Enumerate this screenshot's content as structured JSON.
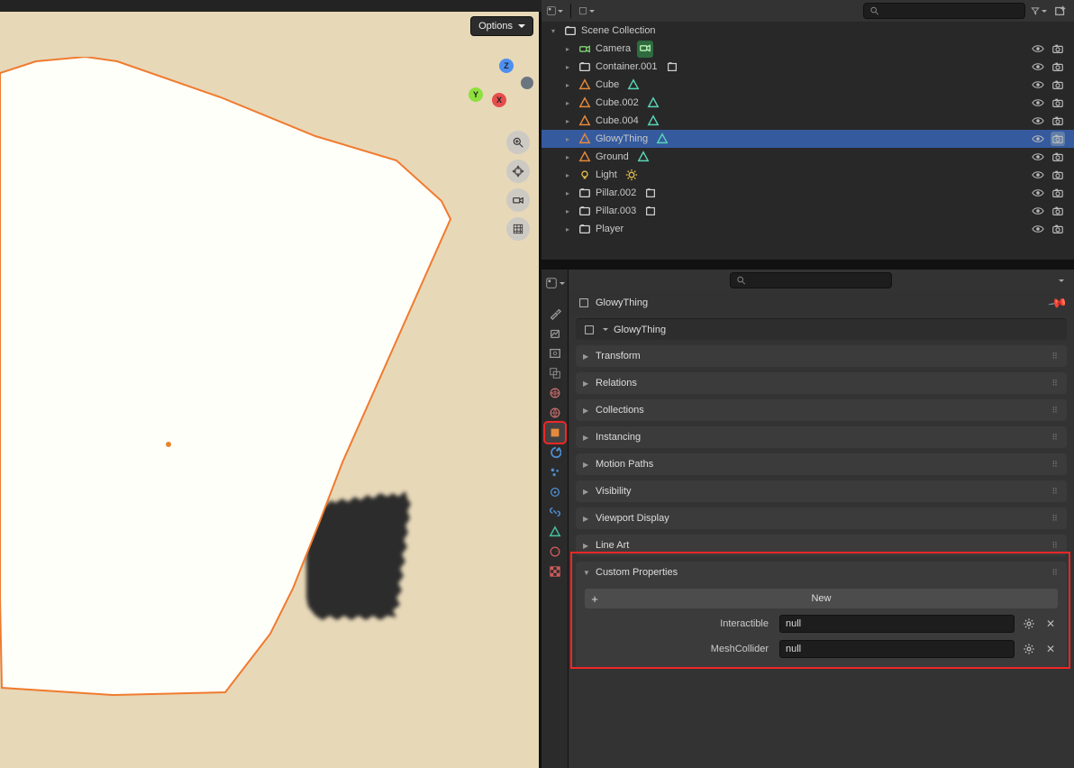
{
  "viewport": {
    "options_label": "Options",
    "gizmo": {
      "z": "Z",
      "y": "Y",
      "x": "X"
    },
    "origin_color": "#e78429",
    "mesh_stroke": "#f07b2f",
    "bg_color": "#e7d8b8"
  },
  "top_toolbar_icons": [
    "cursor",
    "select-box",
    "lasso",
    "circle",
    "tweak",
    "shear"
  ],
  "outliner": {
    "search_placeholder": "",
    "root": {
      "name": "Scene Collection",
      "type": "collection"
    },
    "items": [
      {
        "name": "Camera",
        "type": "camera",
        "extra": "cam",
        "visible": true,
        "render": true
      },
      {
        "name": "Container.001",
        "type": "collection",
        "extra": "box",
        "visible": true,
        "render": true
      },
      {
        "name": "Cube",
        "type": "mesh",
        "extra": "mesh-teal",
        "visible": true,
        "render": true
      },
      {
        "name": "Cube.002",
        "type": "mesh",
        "extra": "mesh-teal",
        "visible": true,
        "render": true
      },
      {
        "name": "Cube.004",
        "type": "mesh",
        "extra": "mesh-teal",
        "visible": true,
        "render": true
      },
      {
        "name": "GlowyThing",
        "type": "mesh",
        "extra": "mesh-teal",
        "visible": true,
        "render": true,
        "selected": true
      },
      {
        "name": "Ground",
        "type": "mesh",
        "extra": "mesh-teal",
        "visible": true,
        "render": true
      },
      {
        "name": "Light",
        "type": "light",
        "extra": "light",
        "visible": true,
        "render": true
      },
      {
        "name": "Pillar.002",
        "type": "collection",
        "extra": "box",
        "visible": true,
        "render": true
      },
      {
        "name": "Pillar.003",
        "type": "collection",
        "extra": "box",
        "visible": true,
        "render": true
      },
      {
        "name": "Player",
        "type": "collection",
        "extra": null,
        "visible": true,
        "render": true
      }
    ]
  },
  "properties": {
    "search_placeholder": "",
    "breadcrumb_object": "GlowyThing",
    "object_name_field": "GlowyThing",
    "panels": [
      {
        "label": "Transform",
        "open": false
      },
      {
        "label": "Relations",
        "open": false
      },
      {
        "label": "Collections",
        "open": false
      },
      {
        "label": "Instancing",
        "open": false
      },
      {
        "label": "Motion Paths",
        "open": false
      },
      {
        "label": "Visibility",
        "open": false
      },
      {
        "label": "Viewport Display",
        "open": false
      },
      {
        "label": "Line Art",
        "open": false
      }
    ],
    "custom_panel": {
      "label": "Custom Properties",
      "new_label": "New",
      "rows": [
        {
          "name": "Interactible",
          "value": "null"
        },
        {
          "name": "MeshCollider",
          "value": "null"
        }
      ]
    },
    "tabs": [
      "tool",
      "render",
      "output",
      "view-layer",
      "scene",
      "world",
      "object",
      "modifiers",
      "particles",
      "physics",
      "constraints",
      "mesh-data",
      "material",
      "texture"
    ],
    "active_tab": "object"
  },
  "highlight_color": "#f02727"
}
